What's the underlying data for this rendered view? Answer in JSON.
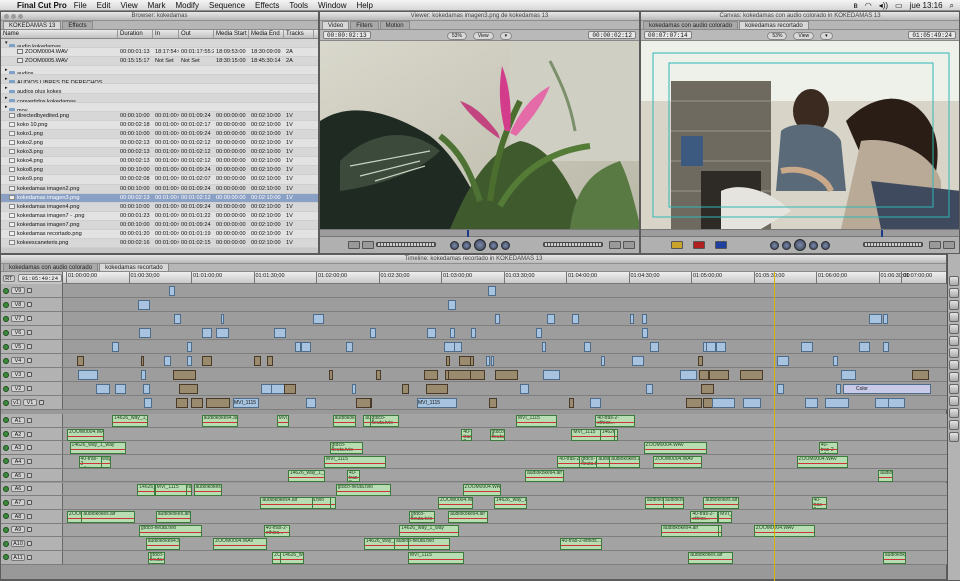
{
  "menubar": {
    "app": "Final Cut Pro",
    "items": [
      "File",
      "Edit",
      "View",
      "Mark",
      "Modify",
      "Sequence",
      "Effects",
      "Tools",
      "Window",
      "Help"
    ],
    "clock": "jue 13:16"
  },
  "browser": {
    "window_title": "Browser: kokedamas",
    "tabs": [
      "KOKEDAMAS 13",
      "Effects"
    ],
    "columns": [
      "Name",
      "Duration",
      "In",
      "Out",
      "Media Start",
      "Media End",
      "Tracks"
    ],
    "rows": [
      {
        "name": "audio kokedamas",
        "type": "folder",
        "open": true,
        "indent": 0,
        "cells": [
          "",
          "",
          "",
          "",
          "",
          ""
        ]
      },
      {
        "name": "ZOOM0004.WAV",
        "type": "audio",
        "indent": 1,
        "cells": [
          "00:00:01:13",
          "18:17:54:0",
          "00:01:17:55:21",
          "18:09:53:00",
          "18:30:09:09",
          "2A"
        ]
      },
      {
        "name": "ZOOM0005.WAV",
        "type": "audio",
        "indent": 1,
        "cells": [
          "00:15:15:17",
          "Not Set",
          "Not Set",
          "18:30:15:00",
          "18:45:30:14",
          "2A"
        ]
      },
      {
        "name": "audios",
        "type": "folder",
        "indent": 0,
        "cells": [
          "",
          "",
          "",
          "",
          "",
          ""
        ]
      },
      {
        "name": "AUDIOS LIBRES DE DERECHOS",
        "type": "folder",
        "indent": 0,
        "cells": [
          "",
          "",
          "",
          "",
          "",
          ""
        ]
      },
      {
        "name": "audios plus kokes",
        "type": "folder",
        "indent": 0,
        "cells": [
          "",
          "",
          "",
          "",
          "",
          ""
        ]
      },
      {
        "name": "convertidos kokedamas",
        "type": "folder",
        "indent": 0,
        "cells": [
          "",
          "",
          "",
          "",
          "",
          ""
        ]
      },
      {
        "name": "mov",
        "type": "folder",
        "indent": 0,
        "cells": [
          "",
          "",
          "",
          "",
          "",
          ""
        ]
      },
      {
        "name": "directedbyedited.png",
        "type": "file",
        "indent": 0,
        "cells": [
          "00:00:10:00",
          "00:01:00:0",
          "00:01:09:24",
          "00:00:00:00",
          "00:02:10:00",
          "1V"
        ]
      },
      {
        "name": "koko 10.png",
        "type": "file",
        "indent": 0,
        "cells": [
          "00:00:02:18",
          "00:01:00:0",
          "00:01:02:17",
          "00:00:00:00",
          "00:02:10:00",
          "1V"
        ]
      },
      {
        "name": "koko1.png",
        "type": "file",
        "indent": 0,
        "cells": [
          "00:00:10:00",
          "00:01:00:0",
          "00:01:09:24",
          "00:00:00:00",
          "00:02:10:00",
          "1V"
        ]
      },
      {
        "name": "koko2.png",
        "type": "file",
        "indent": 0,
        "cells": [
          "00:00:02:13",
          "00:01:00:0",
          "00:01:02:12",
          "00:00:00:00",
          "00:02:10:00",
          "1V"
        ]
      },
      {
        "name": "koko3.png",
        "type": "file",
        "indent": 0,
        "cells": [
          "00:00:02:13",
          "00:01:00:0",
          "00:01:02:12",
          "00:00:00:00",
          "00:02:10:00",
          "1V"
        ]
      },
      {
        "name": "koko4.png",
        "type": "file",
        "indent": 0,
        "cells": [
          "00:00:02:13",
          "00:01:00:0",
          "00:01:02:12",
          "00:00:00:00",
          "00:02:10:00",
          "1V"
        ]
      },
      {
        "name": "koko8.png",
        "type": "file",
        "indent": 0,
        "cells": [
          "00:00:10:00",
          "00:01:00:0",
          "00:01:09:24",
          "00:00:00:00",
          "00:02:10:00",
          "1V"
        ]
      },
      {
        "name": "koko9.png",
        "type": "file",
        "indent": 0,
        "cells": [
          "00:00:02:08",
          "00:01:00:0",
          "00:01:02:07",
          "00:00:00:00",
          "00:02:10:00",
          "1V"
        ]
      },
      {
        "name": "kokedamas imagen2.png",
        "type": "file",
        "indent": 0,
        "cells": [
          "00:00:10:00",
          "00:01:00:0",
          "00:01:09:24",
          "00:00:00:00",
          "00:02:10:00",
          "1V"
        ]
      },
      {
        "name": "kokedamas imagen3.png",
        "type": "file",
        "indent": 0,
        "selected": true,
        "cells": [
          "00:00:02:13",
          "00:01:00:0",
          "00:01:02:12",
          "00:00:00:00",
          "00:02:10:00",
          "1V"
        ]
      },
      {
        "name": "kokedamas imagen4.png",
        "type": "file",
        "indent": 0,
        "cells": [
          "00:00:10:00",
          "00:01:00:0",
          "00:01:09:24",
          "00:00:00:00",
          "00:02:10:00",
          "1V"
        ]
      },
      {
        "name": "kokedamas imagen7 - .png",
        "type": "file",
        "indent": 0,
        "cells": [
          "00:00:01:23",
          "00:01:00:0",
          "00:01:01:22",
          "00:00:00:00",
          "00:02:10:00",
          "1V"
        ]
      },
      {
        "name": "kokedamas imagen7.png",
        "type": "file",
        "indent": 0,
        "cells": [
          "00:00:10:00",
          "00:01:00:0",
          "00:01:09:24",
          "00:00:00:00",
          "00:02:10:00",
          "1V"
        ]
      },
      {
        "name": "kokedamas recortado.png",
        "type": "file",
        "indent": 0,
        "cells": [
          "00:00:01:20",
          "00:01:00:0",
          "00:01:01:19",
          "00:00:00:00",
          "00:02:10:00",
          "1V"
        ]
      },
      {
        "name": "kokeescaneteris.png",
        "type": "file",
        "indent": 0,
        "cells": [
          "00:00:02:16",
          "00:01:00:0",
          "00:01:02:15",
          "00:00:00:00",
          "00:02:10:00",
          "1V"
        ]
      }
    ]
  },
  "viewer": {
    "window_title": "Viewer: kokedamas imagen3.png de kokedamas 13",
    "tabs": [
      "Video",
      "Filters",
      "Motion"
    ],
    "duration": "00:00:02:13",
    "current": "00:00:02:12",
    "zoom": "53%",
    "view": "View"
  },
  "canvas": {
    "window_title": "Canvas: kokedamas con audio colorado in KOKEDAMAS 13",
    "tabs": [
      "kokedamas con audio colorado",
      "kokedamas recortado"
    ],
    "duration": "00:07:07:14",
    "current": "01:05:49:24",
    "zoom": "53%",
    "view": "View"
  },
  "timeline": {
    "window_title": "Timeline: kokedamas recortado in KOKEDAMAS 13",
    "tabs": [
      "kokedamas con audio colorado",
      "kokedamas recortado"
    ],
    "rt": "RT",
    "timecode": "01:05:49:24",
    "ruler": [
      "01:00:00;00",
      "01:00:30;00",
      "01:01:00;00",
      "01:01:30;00",
      "01:02:00;00",
      "01:02:30;00",
      "01:03:00;00",
      "01:03:30;00",
      "01:04:00;00",
      "01:04:30;00",
      "01:05:00;00",
      "01:05:30;00",
      "01:06:00;00",
      "01:06:30;00",
      "01:07:00;00"
    ],
    "video_tracks": [
      "V9",
      "V8",
      "V7",
      "V6",
      "V5",
      "V4",
      "V3",
      "V2",
      "V1"
    ],
    "source_label": "v1",
    "audio_tracks": [
      "A1",
      "A2",
      "A3",
      "A4",
      "A5",
      "A6",
      "A7",
      "A8",
      "A9",
      "A10",
      "A11"
    ],
    "clip_names": {
      "color": "Color",
      "mvi": "MVI_1115",
      "audio_koko": "audiokokes.aif",
      "guitarra": "gtdco-fleuta.tvio",
      "zoom": "ZOOM0004.WAV",
      "tramo": "40-tras-2-ethios...",
      "way": "14626_way_1_way",
      "auto": "audiokokes4.aif"
    }
  }
}
